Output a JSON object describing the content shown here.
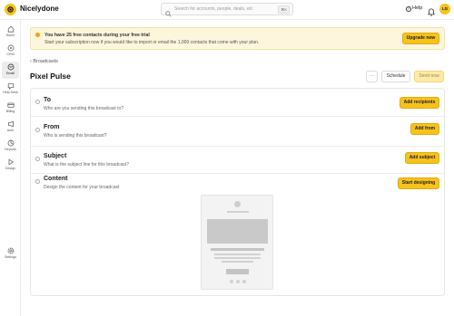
{
  "app": {
    "brand": "Nicelydone"
  },
  "search": {
    "placeholder": "Search for accounts, people, deals, etc",
    "shortcut": "⌘K"
  },
  "header": {
    "help_label": "Help",
    "avatar_initials": "LG"
  },
  "sidebar": {
    "items": [
      {
        "label": "Home",
        "icon": "home-icon",
        "active": false
      },
      {
        "label": "CRM",
        "icon": "crm-icon",
        "active": false
      },
      {
        "label": "Email",
        "icon": "email-icon",
        "active": true
      },
      {
        "label": "Help Desk",
        "icon": "help-desk-icon",
        "active": false
      },
      {
        "label": "Billing",
        "icon": "billing-icon",
        "active": false
      },
      {
        "label": "Auth",
        "icon": "auth-icon",
        "active": false
      },
      {
        "label": "Reports",
        "icon": "reports-icon",
        "active": false
      },
      {
        "label": "Design",
        "icon": "design-icon",
        "active": false
      }
    ],
    "settings_label": "Settings"
  },
  "banner": {
    "title": "You have 25 free contacts during your free trial",
    "text": "Start your subscription now if you would like to import or email the 1,000 contacts that come with your plan.",
    "button": "Upgrade now"
  },
  "breadcrumb": {
    "label": "Broadcasts"
  },
  "page": {
    "title": "Pixel Pulse",
    "more_label": "···",
    "schedule_label": "Schedule",
    "send_label": "Send now"
  },
  "sections": [
    {
      "title": "To",
      "subtitle": "Who are you sending this broadcast to?",
      "button": "Add recipients"
    },
    {
      "title": "From",
      "subtitle": "Who is sending this broadcast?",
      "button": "Add from"
    },
    {
      "title": "Subject",
      "subtitle": "What is the subject line for this broadcast?",
      "button": "Add subject"
    },
    {
      "title": "Content",
      "subtitle": "Design the content for your broadcast",
      "button": "Start designing"
    }
  ],
  "colors": {
    "accent": "#f6c21c",
    "banner_bg": "#fdf6dd",
    "active_nav": "#ececec"
  }
}
